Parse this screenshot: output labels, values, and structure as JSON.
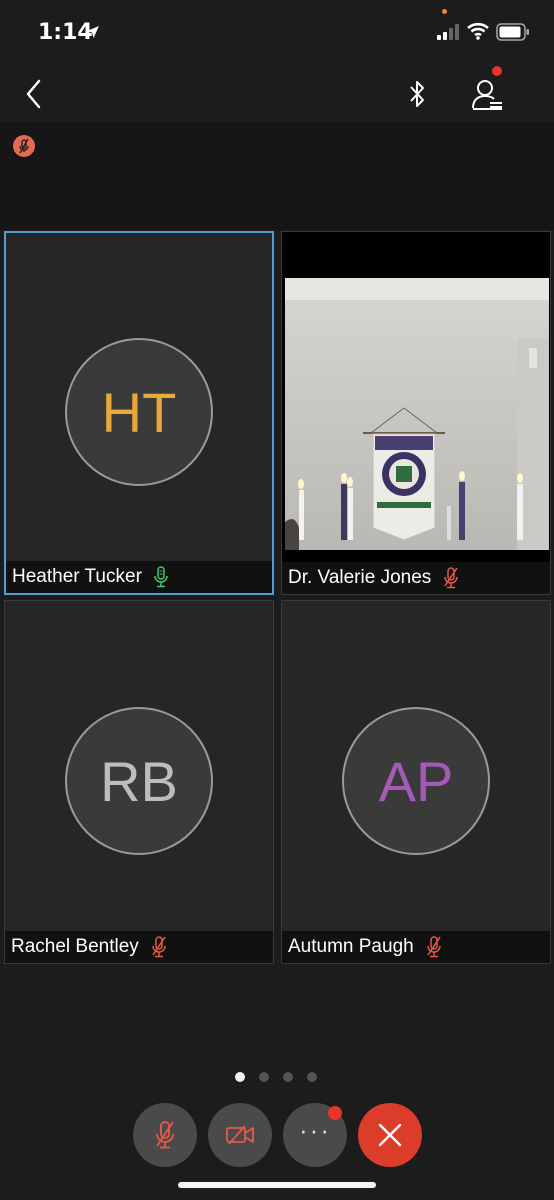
{
  "status_bar": {
    "time": "1:14",
    "location_icon": "location-arrow-icon",
    "signal_icon": "cellular-signal-icon",
    "wifi_icon": "wifi-icon",
    "battery_icon": "battery-icon"
  },
  "nav": {
    "back_icon": "chevron-left-icon",
    "bluetooth_icon": "bluetooth-icon",
    "participants_icon": "participants-list-icon"
  },
  "participants": [
    {
      "name": "Heather Tucker",
      "initials": "HT",
      "initials_color": "#e8a83a",
      "mic": "active",
      "active_speaker": true
    },
    {
      "name": "Dr. Valerie Jones",
      "initials": "",
      "mic": "muted",
      "video": true
    },
    {
      "name": "Rachel Bentley",
      "initials": "RB",
      "initials_color": "#bdbdbd",
      "mic": "muted"
    },
    {
      "name": "Autumn Paugh",
      "initials": "AP",
      "initials_color": "#a45bb5",
      "mic": "muted"
    }
  ],
  "pagination": {
    "pages": 4,
    "current": 1
  },
  "controls": {
    "mute_icon": "microphone-muted-icon",
    "video_icon": "video-off-icon",
    "more_label": "···",
    "leave_icon": "close-icon"
  },
  "colors": {
    "accent_border": "#4f9fd6",
    "muted_red": "#e8584a",
    "mic_green": "#3fc76a",
    "leave_red": "#db3d2a"
  }
}
